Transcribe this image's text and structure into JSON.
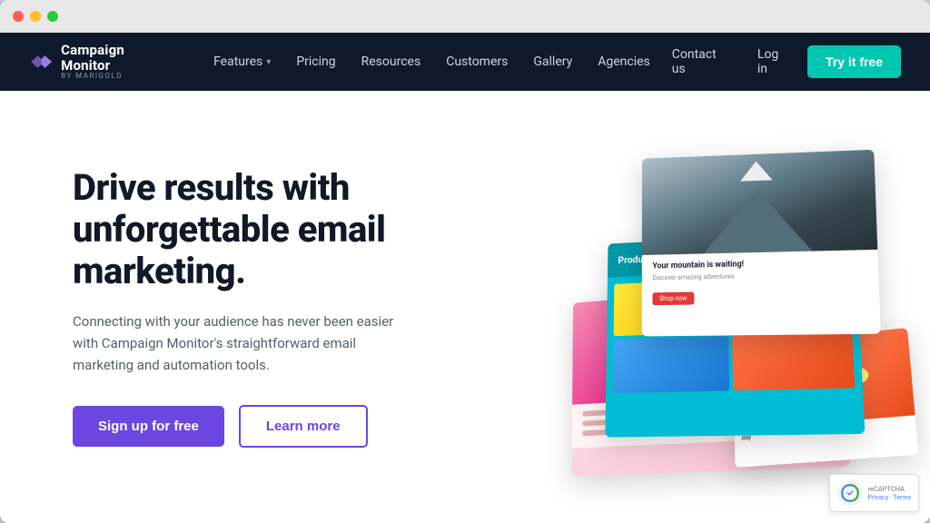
{
  "browser": {
    "dots": [
      "red",
      "yellow",
      "green"
    ]
  },
  "nav": {
    "logo_main": "Campaign Monitor",
    "logo_sub": "by Marigold",
    "links": [
      {
        "label": "Features",
        "hasDropdown": true
      },
      {
        "label": "Pricing",
        "hasDropdown": false
      },
      {
        "label": "Resources",
        "hasDropdown": false
      },
      {
        "label": "Customers",
        "hasDropdown": false
      },
      {
        "label": "Gallery",
        "hasDropdown": false
      },
      {
        "label": "Agencies",
        "hasDropdown": false
      }
    ],
    "contact_label": "Contact us",
    "login_label": "Log in",
    "try_label": "Try it free"
  },
  "hero": {
    "heading": "Drive results with unforgettable email marketing.",
    "subtext": "Connecting with your audience has never been easier with Campaign Monitor's straightforward email marketing and automation tools.",
    "signup_label": "Sign up for free",
    "learn_label": "Learn more"
  },
  "recaptcha": {
    "protected": "reCAPTCHA",
    "links": "Privacy · Terms"
  },
  "colors": {
    "nav_bg": "#0e1a2b",
    "accent_purple": "#6b46e0",
    "accent_teal": "#00c8b0",
    "text_dark": "#111827",
    "text_muted": "#555f6d"
  }
}
